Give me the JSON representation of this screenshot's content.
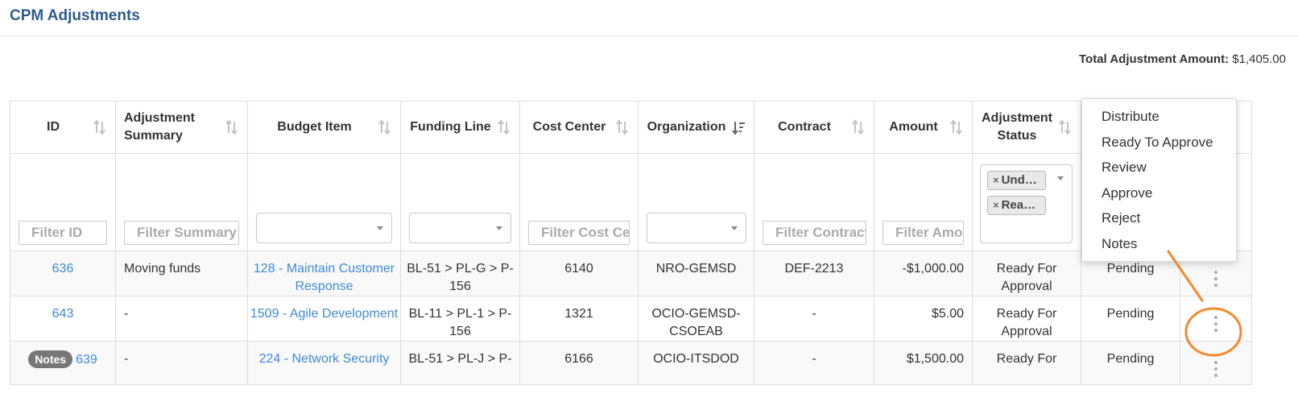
{
  "page": {
    "title": "CPM Adjustments"
  },
  "total": {
    "label": "Total Adjustment Amount:",
    "value": "$1,405.00"
  },
  "columns": [
    {
      "label": "ID"
    },
    {
      "label": "Adjustment Summary"
    },
    {
      "label": "Budget Item"
    },
    {
      "label": "Funding Line"
    },
    {
      "label": "Cost Center"
    },
    {
      "label": "Organization",
      "sort": "active-desc"
    },
    {
      "label": "Contract"
    },
    {
      "label": "Amount"
    },
    {
      "label": "Adjustment Status"
    }
  ],
  "filters": {
    "id": {
      "placeholder": "Filter ID"
    },
    "summary": {
      "placeholder": "Filter Summary"
    },
    "cost_center": {
      "placeholder": "Filter Cost Center"
    },
    "contract": {
      "placeholder": "Filter Contract"
    },
    "amount": {
      "placeholder": "Filter Amount"
    },
    "status_chips": [
      "Und…",
      "Rea…"
    ]
  },
  "rows": [
    {
      "id": "636",
      "summary": "Moving funds",
      "budget_item": "128 - Maintain Customer Response",
      "funding_line": "BL-51 > PL-G > P-156",
      "cost_center": "6140",
      "organization": "NRO-GEMSD",
      "contract": "DEF-2213",
      "amount": "-$1,000.00",
      "status": "Ready For Approval",
      "approval": "Pending"
    },
    {
      "id": "643",
      "summary": "-",
      "budget_item": "1509 - Agile Development",
      "funding_line": "BL-11 > PL-1 > P-156",
      "cost_center": "1321",
      "organization": "OCIO-GEMSD-CSOEAB",
      "contract": "-",
      "amount": "$5.00",
      "status": "Ready For Approval",
      "approval": "Pending"
    },
    {
      "badge": "Notes",
      "id": "639",
      "summary": "-",
      "budget_item": "224 - Network Security",
      "funding_line": "BL-51 > PL-J > P-",
      "cost_center": "6166",
      "organization": "OCIO-ITSDOD",
      "contract": "-",
      "amount": "$1,500.00",
      "status": "Ready For",
      "approval": "Pending"
    }
  ],
  "menu": {
    "items": [
      "Distribute",
      "Ready To Approve",
      "Review",
      "Approve",
      "Reject",
      "Notes"
    ]
  },
  "annotation": {
    "color": "#f08a2e"
  }
}
